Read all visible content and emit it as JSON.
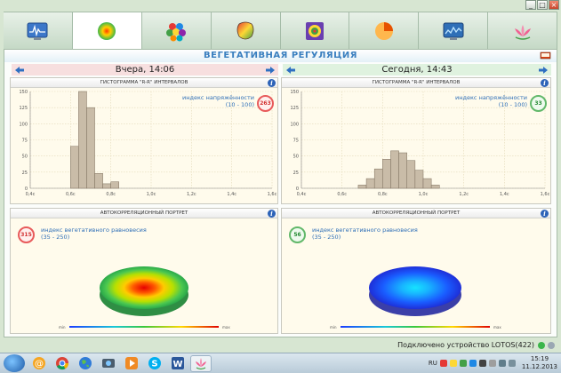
{
  "window": {
    "min_glyph": "_",
    "max_glyph": "□",
    "close_glyph": "×"
  },
  "tabs": [
    {
      "icon": "ecg-monitor-icon",
      "active": false
    },
    {
      "icon": "vegetative-sphere-icon",
      "active": true
    },
    {
      "icon": "molecule-icon",
      "active": false
    },
    {
      "icon": "brain-map-icon",
      "active": false
    },
    {
      "icon": "target-icon",
      "active": false
    },
    {
      "icon": "pie-chart-icon",
      "active": false
    },
    {
      "icon": "wave-monitor-icon",
      "active": false
    },
    {
      "icon": "lotus-icon",
      "active": false
    }
  ],
  "header": {
    "title": "ВЕГЕТАТИВНАЯ РЕГУЛЯЦИЯ"
  },
  "left": {
    "day": "Вчера, 14:06",
    "histogram": {
      "title": "ГИСТОГРАММА \"R-R\" ИНТЕРВАЛОВ",
      "metric_label": "индекс напряжённости",
      "metric_range": "(10 - 100)",
      "metric_value": "263"
    },
    "portrait": {
      "title": "АВТОКОРРЕЛЯЦИОННЫЙ ПОРТРЕТ",
      "metric_label": "индекс вегетативного равновесия",
      "metric_range": "(35 - 250)",
      "metric_value": "315",
      "scale_min": "min",
      "scale_max": "max"
    }
  },
  "right": {
    "day": "Сегодня, 14:43",
    "histogram": {
      "title": "ГИСТОГРАММА \"R-R\" ИНТЕРВАЛОВ",
      "metric_label": "индекс напряжённости",
      "metric_range": "(10 - 100)",
      "metric_value": "33"
    },
    "portrait": {
      "title": "АВТОКОРРЕЛЯЦИОННЫЙ ПОРТРЕТ",
      "metric_label": "индекс вегетативного равновесия",
      "metric_range": "(35 - 250)",
      "metric_value": "56",
      "scale_min": "min",
      "scale_max": "max"
    }
  },
  "chart_data": [
    {
      "type": "bar",
      "title": "ГИСТОГРАММА \"R-R\" ИНТЕРВАЛОВ",
      "x_ticks": [
        "0,4c",
        "0,6c",
        "0,8c",
        "1,0c",
        "1,2c",
        "1,4c",
        "1,6c"
      ],
      "y_ticks": [
        "0",
        "25",
        "50",
        "75",
        "100",
        "125",
        "150"
      ],
      "xlim": [
        0.4,
        1.6
      ],
      "ylim": [
        0,
        150
      ],
      "bins": [
        {
          "x0": 0.6,
          "x1": 0.64,
          "value": 65
        },
        {
          "x0": 0.64,
          "x1": 0.68,
          "value": 150
        },
        {
          "x0": 0.68,
          "x1": 0.72,
          "value": 125
        },
        {
          "x0": 0.72,
          "x1": 0.76,
          "value": 23
        },
        {
          "x0": 0.76,
          "x1": 0.8,
          "value": 7
        },
        {
          "x0": 0.8,
          "x1": 0.84,
          "value": 10
        }
      ]
    },
    {
      "type": "bar",
      "title": "ГИСТОГРАММА \"R-R\" ИНТЕРВАЛОВ",
      "x_ticks": [
        "0,4c",
        "0,6c",
        "0,8c",
        "1,0c",
        "1,2c",
        "1,4c",
        "1,6c"
      ],
      "y_ticks": [
        "0",
        "25",
        "50",
        "75",
        "100",
        "125",
        "150"
      ],
      "xlim": [
        0.4,
        1.6
      ],
      "ylim": [
        0,
        150
      ],
      "bins": [
        {
          "x0": 0.68,
          "x1": 0.72,
          "value": 5
        },
        {
          "x0": 0.72,
          "x1": 0.76,
          "value": 15
        },
        {
          "x0": 0.76,
          "x1": 0.8,
          "value": 30
        },
        {
          "x0": 0.8,
          "x1": 0.84,
          "value": 45
        },
        {
          "x0": 0.84,
          "x1": 0.88,
          "value": 58
        },
        {
          "x0": 0.88,
          "x1": 0.92,
          "value": 55
        },
        {
          "x0": 0.92,
          "x1": 0.96,
          "value": 43
        },
        {
          "x0": 0.96,
          "x1": 1.0,
          "value": 28
        },
        {
          "x0": 1.0,
          "x1": 1.04,
          "value": 15
        },
        {
          "x0": 1.04,
          "x1": 1.08,
          "value": 5
        }
      ]
    }
  ],
  "status": {
    "connection": "Подключено устройство LOTOS(422)"
  },
  "taskbar": {
    "apps": [
      "mail-icon",
      "chrome-icon",
      "globe-icon",
      "media-center-icon",
      "video-player-icon",
      "skype-icon",
      "word-icon",
      "lotus-app-icon"
    ],
    "lang": "RU",
    "time": "15:19",
    "date": "11.12.2013"
  },
  "colors": {
    "accent": "#3a7fbf",
    "bar_fill": "#c9bca8",
    "bar_stroke": "#7d6f5d",
    "red": "#e85b5b",
    "green": "#62b86a"
  }
}
